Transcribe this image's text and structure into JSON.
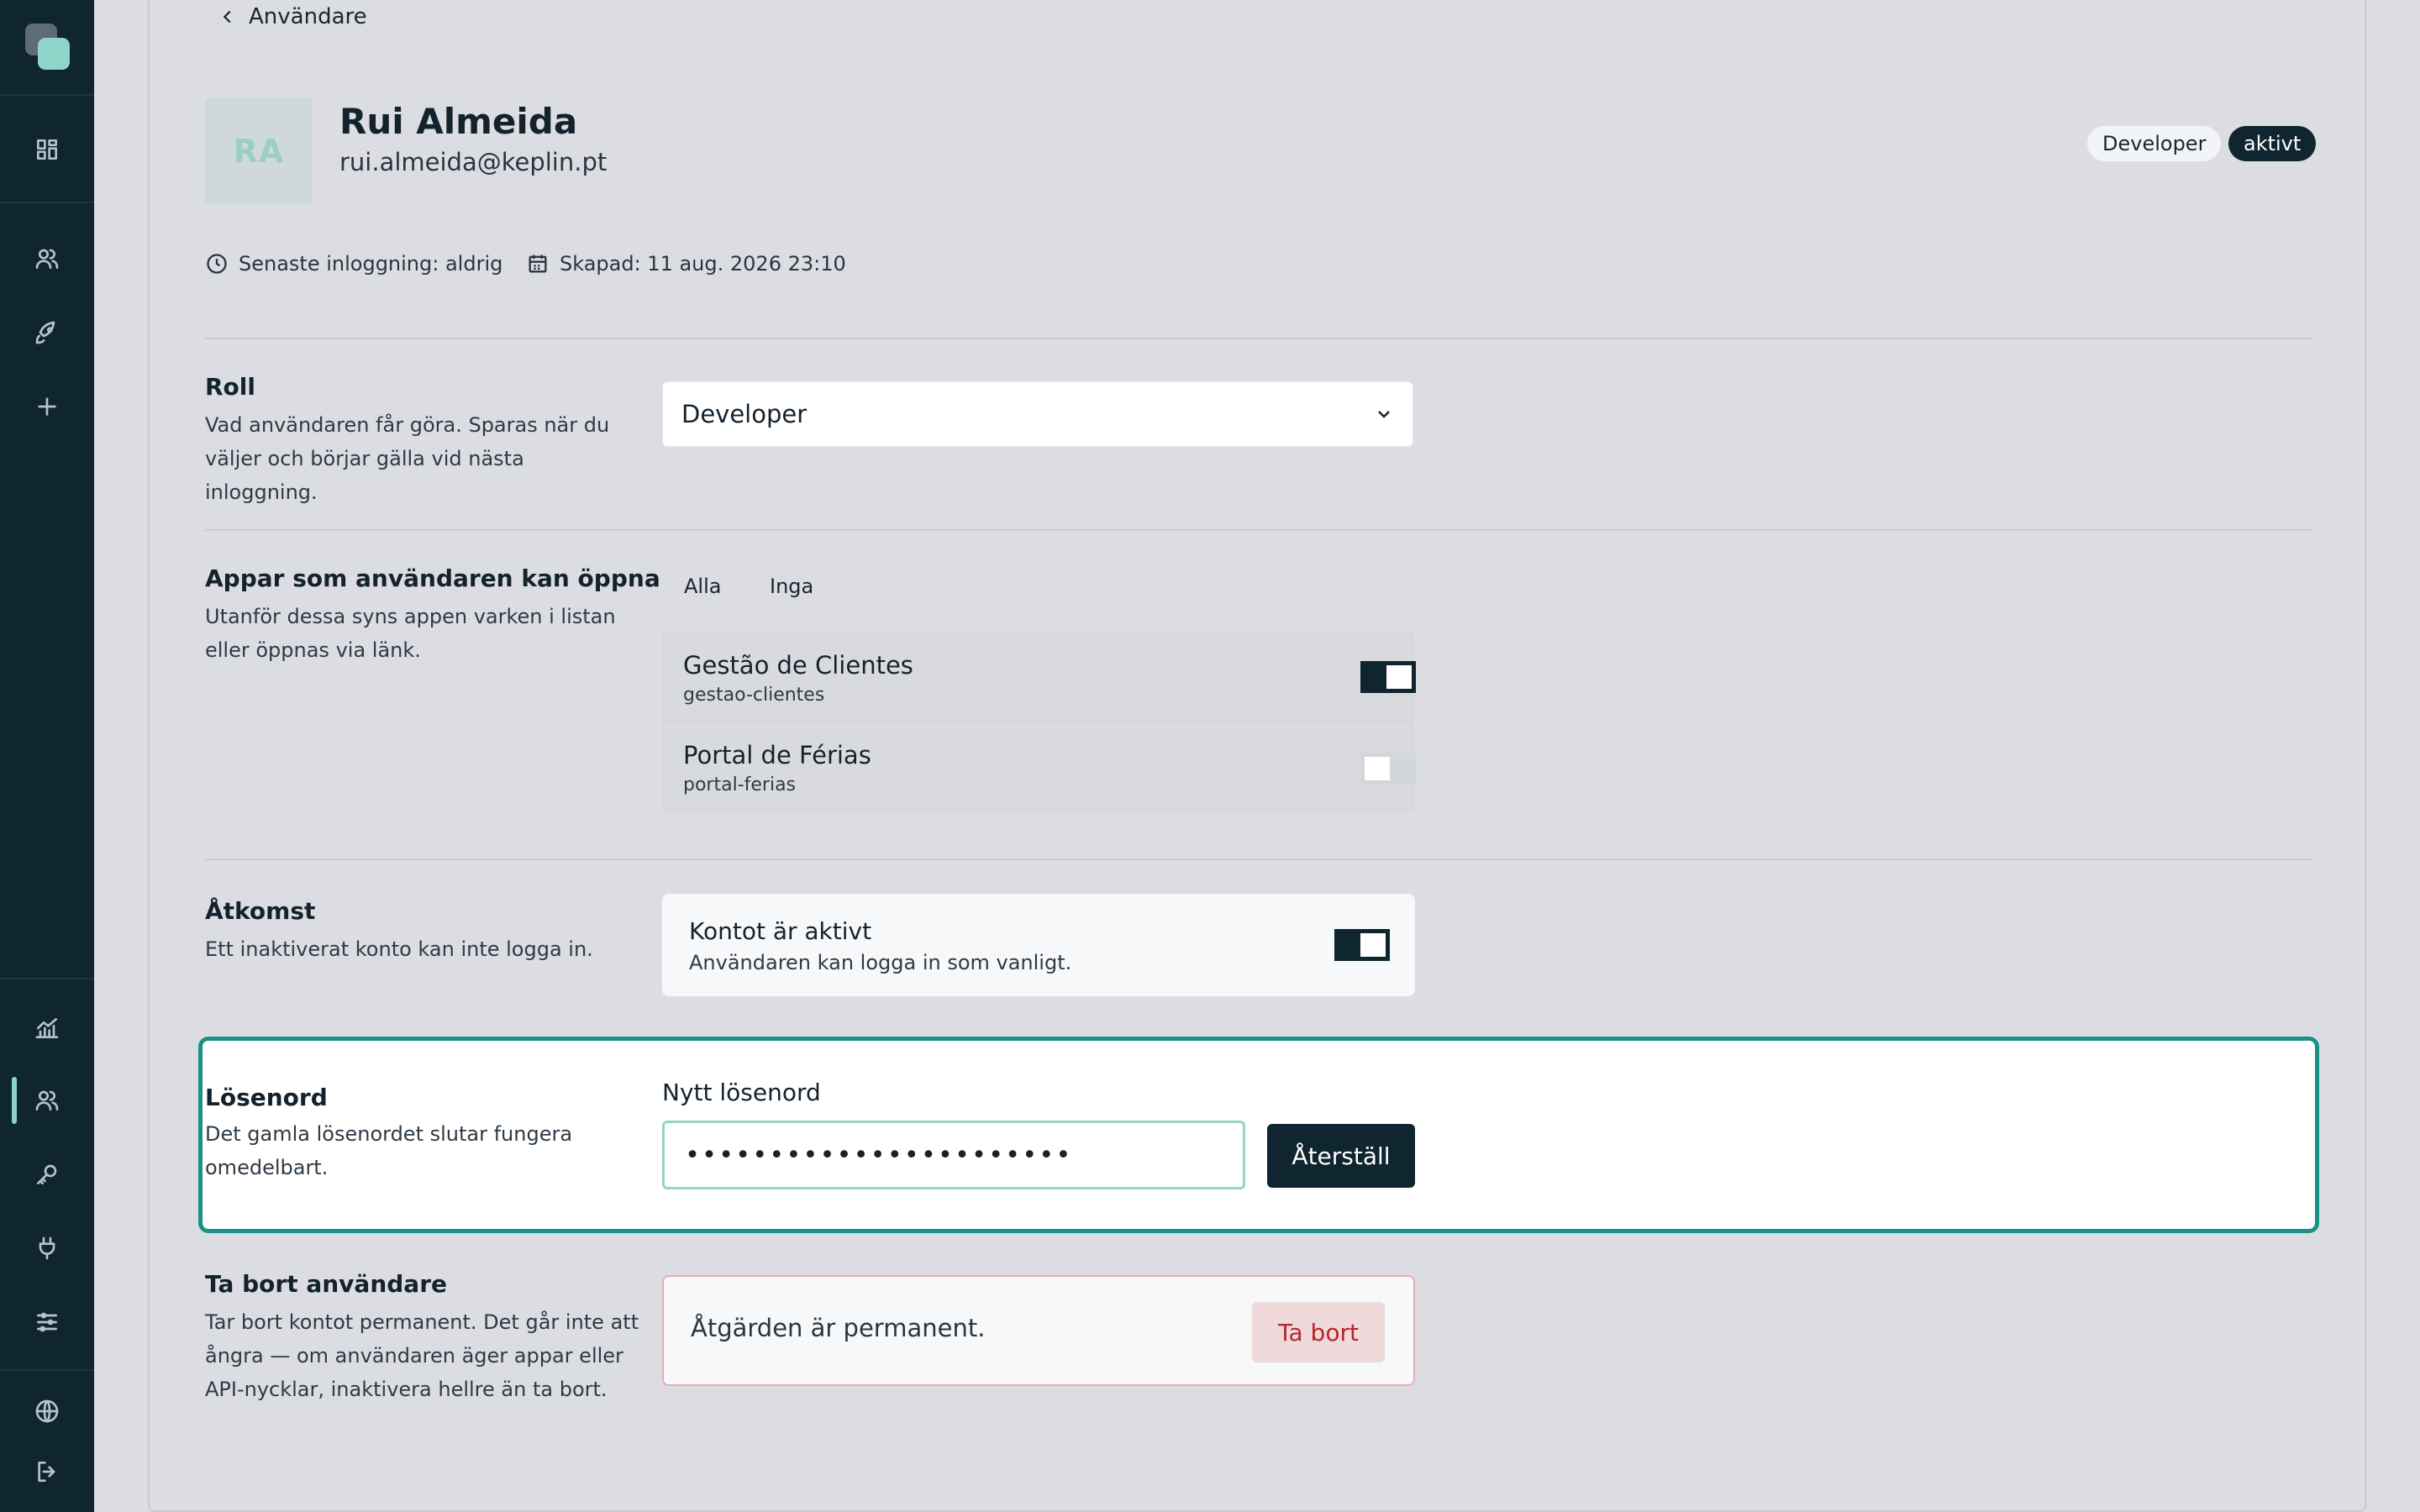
{
  "back": {
    "label": "Användare"
  },
  "user": {
    "initials": "RA",
    "name": "Rui Almeida",
    "email": "rui.almeida@keplin.pt",
    "role_badge": "Developer",
    "status_badge": "aktivt",
    "last_login": "Senaste inloggning: aldrig",
    "created": "Skapad: 11 aug. 2026 23:10"
  },
  "role": {
    "title": "Roll",
    "description": "Vad användaren får göra. Sparas när du väljer och börjar gälla vid nästa inloggning.",
    "selected": "Developer"
  },
  "apps": {
    "title": "Appar som användaren kan öppna",
    "description": "Utanför dessa syns appen varken i listan eller öppnas via länk.",
    "select_all": "Alla",
    "select_none": "Inga",
    "items": [
      {
        "name": "Gestão de Clientes",
        "slug": "gestao-clientes",
        "enabled": true
      },
      {
        "name": "Portal de Férias",
        "slug": "portal-ferias",
        "enabled": false
      }
    ]
  },
  "access": {
    "title": "Åtkomst",
    "description": "Ett inaktiverat konto kan inte logga in.",
    "toggle_title": "Kontot är aktivt",
    "toggle_desc": "Användaren kan logga in som vanligt.",
    "active": true
  },
  "password": {
    "title": "Lösenord",
    "description": "Det gamla lösenordet slutar fungera omedelbart.",
    "field_label": "Nytt lösenord",
    "value": "•••••••••••••••••••••••",
    "reset_label": "Återställ"
  },
  "delete": {
    "title": "Ta bort användare",
    "description": "Tar bort kontot permanent. Det går inte att ångra — om användaren äger appar eller API-nycklar, inaktivera hellre än ta bort.",
    "notice": "Åtgärden är permanent.",
    "button_label": "Ta bort"
  },
  "colors": {
    "sidebar": "#0f2530",
    "accent": "#1a9187",
    "danger": "#b8242a"
  },
  "sidebar_icons": [
    "dashboard-icon",
    "users-icon",
    "rocket-icon",
    "plus-icon",
    "chart-icon",
    "users-icon",
    "key-icon",
    "plug-icon",
    "sliders-icon",
    "globe-icon",
    "logout-icon"
  ]
}
